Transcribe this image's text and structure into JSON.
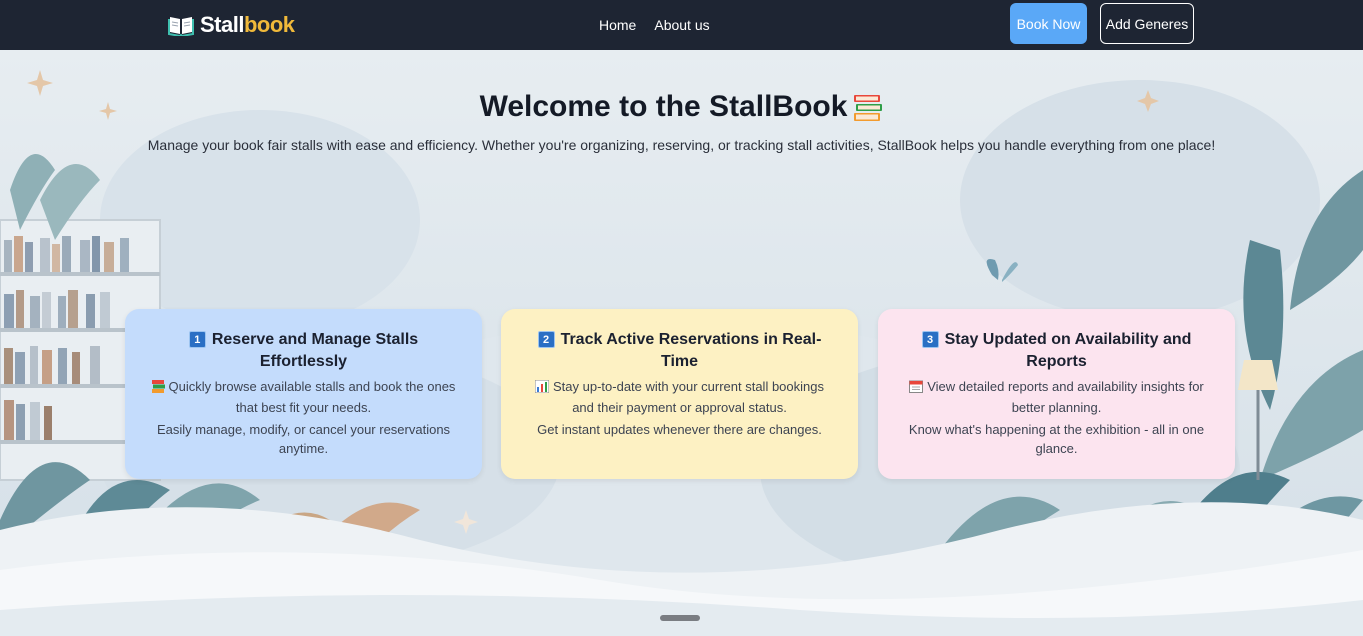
{
  "brand": {
    "part1": "Stall",
    "part2": "book",
    "accent_color": "#f0b93a"
  },
  "nav": {
    "home": "Home",
    "about": "About us"
  },
  "actions": {
    "book_now": "Book Now",
    "add_genres": "Add Generes"
  },
  "hero": {
    "title": "Welcome to the StallBook",
    "title_icon": "books-icon",
    "subtitle": "Manage your book fair stalls with ease and efficiency. Whether you're organizing, reserving, or tracking stall activities, StallBook helps you handle everything from one place!"
  },
  "cards": [
    {
      "number": "1",
      "title": "Reserve and Manage Stalls Effortlessly",
      "icon": "books-icon",
      "line1": "Quickly browse available stalls and book the ones that best fit your needs.",
      "line2": "Easily manage, modify, or cancel your reservations anytime.",
      "color": "#c4dcfc"
    },
    {
      "number": "2",
      "title": "Track Active Reservations in Real-Time",
      "icon": "bar-chart-icon",
      "line1": "Stay up-to-date with your current stall bookings and their payment or approval status.",
      "line2": "Get instant updates whenever there are changes.",
      "color": "#fdf1c3"
    },
    {
      "number": "3",
      "title": "Stay Updated on Availability and Reports",
      "icon": "calendar-icon",
      "line1": "View detailed reports and availability insights for better planning.",
      "line2": "Know what's happening at the exhibition - all in one glance.",
      "color": "#fce4ef"
    }
  ],
  "colors": {
    "navbar": "#1e2533",
    "book_now_button": "#5aa8f7"
  }
}
